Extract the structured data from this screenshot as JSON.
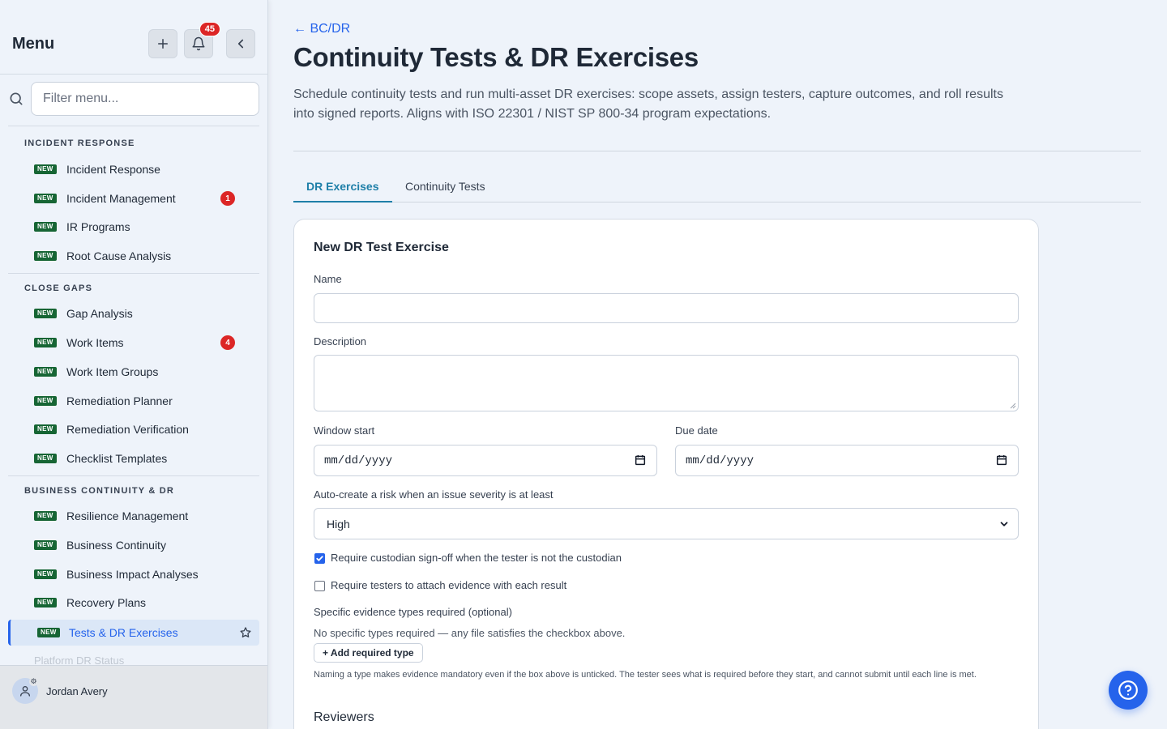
{
  "sidebar": {
    "title": "Menu",
    "notifications_count": "45",
    "filter_placeholder": "Filter menu...",
    "new_tag": "NEW",
    "sections": [
      {
        "title": "INCIDENT RESPONSE",
        "items": [
          {
            "label": "Incident Response"
          },
          {
            "label": "Incident Management",
            "badge": "1"
          },
          {
            "label": "IR Programs"
          },
          {
            "label": "Root Cause Analysis"
          }
        ]
      },
      {
        "title": "CLOSE GAPS",
        "items": [
          {
            "label": "Gap Analysis"
          },
          {
            "label": "Work Items",
            "badge": "4"
          },
          {
            "label": "Work Item Groups"
          },
          {
            "label": "Remediation Planner"
          },
          {
            "label": "Remediation Verification"
          },
          {
            "label": "Checklist Templates"
          }
        ]
      },
      {
        "title": "BUSINESS CONTINUITY & DR",
        "items": [
          {
            "label": "Resilience Management"
          },
          {
            "label": "Business Continuity"
          },
          {
            "label": "Business Impact Analyses"
          },
          {
            "label": "Recovery Plans"
          },
          {
            "label": "Tests & DR Exercises",
            "active": true
          },
          {
            "label": "Platform DR Status"
          }
        ]
      }
    ],
    "user_name": "Jordan Avery"
  },
  "main": {
    "back_link": "← BC/DR",
    "title": "Continuity Tests & DR Exercises",
    "description": "Schedule continuity tests and run multi-asset DR exercises: scope assets, assign testers, capture outcomes, and roll results into signed reports. Aligns with ISO 22301 / NIST SP 800-34 program expectations.",
    "tabs": [
      {
        "label": "DR Exercises",
        "active": true
      },
      {
        "label": "Continuity Tests"
      }
    ],
    "form": {
      "title": "New DR Test Exercise",
      "name_label": "Name",
      "name_value": "",
      "description_label": "Description",
      "description_value": "",
      "window_start_label": "Window start",
      "window_start_value": "mm/dd/yyyy",
      "due_date_label": "Due date",
      "due_date_value": "mm/dd/yyyy",
      "severity_label": "Auto-create a risk when an issue severity is at least",
      "severity_value": "High",
      "custodian_signoff_label": "Require custodian sign-off when the tester is not the custodian",
      "custodian_signoff_checked": true,
      "evidence_label": "Require testers to attach evidence with each result",
      "evidence_checked": false,
      "evidence_types_label": "Specific evidence types required (optional)",
      "evidence_types_empty": "No specific types required — any file satisfies the checkbox above.",
      "add_type_button": "+ Add required type",
      "hint": "Naming a type makes evidence mandatory even if the box above is unticked. The tester sees what is required before they start, and cannot submit until each line is met.",
      "reviewers_label": "Reviewers"
    }
  },
  "colors": {
    "accent": "#2563eb",
    "tab_active": "#1e7fa8",
    "badge": "#dc2626",
    "new_tag": "#166534"
  }
}
